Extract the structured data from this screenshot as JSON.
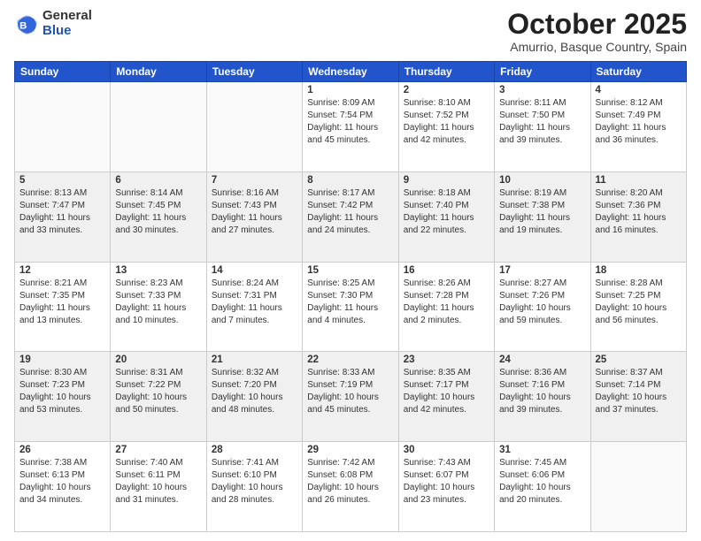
{
  "logo": {
    "general": "General",
    "blue": "Blue"
  },
  "header": {
    "month": "October 2025",
    "location": "Amurrio, Basque Country, Spain"
  },
  "weekdays": [
    "Sunday",
    "Monday",
    "Tuesday",
    "Wednesday",
    "Thursday",
    "Friday",
    "Saturday"
  ],
  "weeks": [
    [
      {
        "day": "",
        "sunrise": "",
        "sunset": "",
        "daylight": ""
      },
      {
        "day": "",
        "sunrise": "",
        "sunset": "",
        "daylight": ""
      },
      {
        "day": "",
        "sunrise": "",
        "sunset": "",
        "daylight": ""
      },
      {
        "day": "1",
        "sunrise": "Sunrise: 8:09 AM",
        "sunset": "Sunset: 7:54 PM",
        "daylight": "Daylight: 11 hours and 45 minutes."
      },
      {
        "day": "2",
        "sunrise": "Sunrise: 8:10 AM",
        "sunset": "Sunset: 7:52 PM",
        "daylight": "Daylight: 11 hours and 42 minutes."
      },
      {
        "day": "3",
        "sunrise": "Sunrise: 8:11 AM",
        "sunset": "Sunset: 7:50 PM",
        "daylight": "Daylight: 11 hours and 39 minutes."
      },
      {
        "day": "4",
        "sunrise": "Sunrise: 8:12 AM",
        "sunset": "Sunset: 7:49 PM",
        "daylight": "Daylight: 11 hours and 36 minutes."
      }
    ],
    [
      {
        "day": "5",
        "sunrise": "Sunrise: 8:13 AM",
        "sunset": "Sunset: 7:47 PM",
        "daylight": "Daylight: 11 hours and 33 minutes."
      },
      {
        "day": "6",
        "sunrise": "Sunrise: 8:14 AM",
        "sunset": "Sunset: 7:45 PM",
        "daylight": "Daylight: 11 hours and 30 minutes."
      },
      {
        "day": "7",
        "sunrise": "Sunrise: 8:16 AM",
        "sunset": "Sunset: 7:43 PM",
        "daylight": "Daylight: 11 hours and 27 minutes."
      },
      {
        "day": "8",
        "sunrise": "Sunrise: 8:17 AM",
        "sunset": "Sunset: 7:42 PM",
        "daylight": "Daylight: 11 hours and 24 minutes."
      },
      {
        "day": "9",
        "sunrise": "Sunrise: 8:18 AM",
        "sunset": "Sunset: 7:40 PM",
        "daylight": "Daylight: 11 hours and 22 minutes."
      },
      {
        "day": "10",
        "sunrise": "Sunrise: 8:19 AM",
        "sunset": "Sunset: 7:38 PM",
        "daylight": "Daylight: 11 hours and 19 minutes."
      },
      {
        "day": "11",
        "sunrise": "Sunrise: 8:20 AM",
        "sunset": "Sunset: 7:36 PM",
        "daylight": "Daylight: 11 hours and 16 minutes."
      }
    ],
    [
      {
        "day": "12",
        "sunrise": "Sunrise: 8:21 AM",
        "sunset": "Sunset: 7:35 PM",
        "daylight": "Daylight: 11 hours and 13 minutes."
      },
      {
        "day": "13",
        "sunrise": "Sunrise: 8:23 AM",
        "sunset": "Sunset: 7:33 PM",
        "daylight": "Daylight: 11 hours and 10 minutes."
      },
      {
        "day": "14",
        "sunrise": "Sunrise: 8:24 AM",
        "sunset": "Sunset: 7:31 PM",
        "daylight": "Daylight: 11 hours and 7 minutes."
      },
      {
        "day": "15",
        "sunrise": "Sunrise: 8:25 AM",
        "sunset": "Sunset: 7:30 PM",
        "daylight": "Daylight: 11 hours and 4 minutes."
      },
      {
        "day": "16",
        "sunrise": "Sunrise: 8:26 AM",
        "sunset": "Sunset: 7:28 PM",
        "daylight": "Daylight: 11 hours and 2 minutes."
      },
      {
        "day": "17",
        "sunrise": "Sunrise: 8:27 AM",
        "sunset": "Sunset: 7:26 PM",
        "daylight": "Daylight: 10 hours and 59 minutes."
      },
      {
        "day": "18",
        "sunrise": "Sunrise: 8:28 AM",
        "sunset": "Sunset: 7:25 PM",
        "daylight": "Daylight: 10 hours and 56 minutes."
      }
    ],
    [
      {
        "day": "19",
        "sunrise": "Sunrise: 8:30 AM",
        "sunset": "Sunset: 7:23 PM",
        "daylight": "Daylight: 10 hours and 53 minutes."
      },
      {
        "day": "20",
        "sunrise": "Sunrise: 8:31 AM",
        "sunset": "Sunset: 7:22 PM",
        "daylight": "Daylight: 10 hours and 50 minutes."
      },
      {
        "day": "21",
        "sunrise": "Sunrise: 8:32 AM",
        "sunset": "Sunset: 7:20 PM",
        "daylight": "Daylight: 10 hours and 48 minutes."
      },
      {
        "day": "22",
        "sunrise": "Sunrise: 8:33 AM",
        "sunset": "Sunset: 7:19 PM",
        "daylight": "Daylight: 10 hours and 45 minutes."
      },
      {
        "day": "23",
        "sunrise": "Sunrise: 8:35 AM",
        "sunset": "Sunset: 7:17 PM",
        "daylight": "Daylight: 10 hours and 42 minutes."
      },
      {
        "day": "24",
        "sunrise": "Sunrise: 8:36 AM",
        "sunset": "Sunset: 7:16 PM",
        "daylight": "Daylight: 10 hours and 39 minutes."
      },
      {
        "day": "25",
        "sunrise": "Sunrise: 8:37 AM",
        "sunset": "Sunset: 7:14 PM",
        "daylight": "Daylight: 10 hours and 37 minutes."
      }
    ],
    [
      {
        "day": "26",
        "sunrise": "Sunrise: 7:38 AM",
        "sunset": "Sunset: 6:13 PM",
        "daylight": "Daylight: 10 hours and 34 minutes."
      },
      {
        "day": "27",
        "sunrise": "Sunrise: 7:40 AM",
        "sunset": "Sunset: 6:11 PM",
        "daylight": "Daylight: 10 hours and 31 minutes."
      },
      {
        "day": "28",
        "sunrise": "Sunrise: 7:41 AM",
        "sunset": "Sunset: 6:10 PM",
        "daylight": "Daylight: 10 hours and 28 minutes."
      },
      {
        "day": "29",
        "sunrise": "Sunrise: 7:42 AM",
        "sunset": "Sunset: 6:08 PM",
        "daylight": "Daylight: 10 hours and 26 minutes."
      },
      {
        "day": "30",
        "sunrise": "Sunrise: 7:43 AM",
        "sunset": "Sunset: 6:07 PM",
        "daylight": "Daylight: 10 hours and 23 minutes."
      },
      {
        "day": "31",
        "sunrise": "Sunrise: 7:45 AM",
        "sunset": "Sunset: 6:06 PM",
        "daylight": "Daylight: 10 hours and 20 minutes."
      },
      {
        "day": "",
        "sunrise": "",
        "sunset": "",
        "daylight": ""
      }
    ]
  ]
}
